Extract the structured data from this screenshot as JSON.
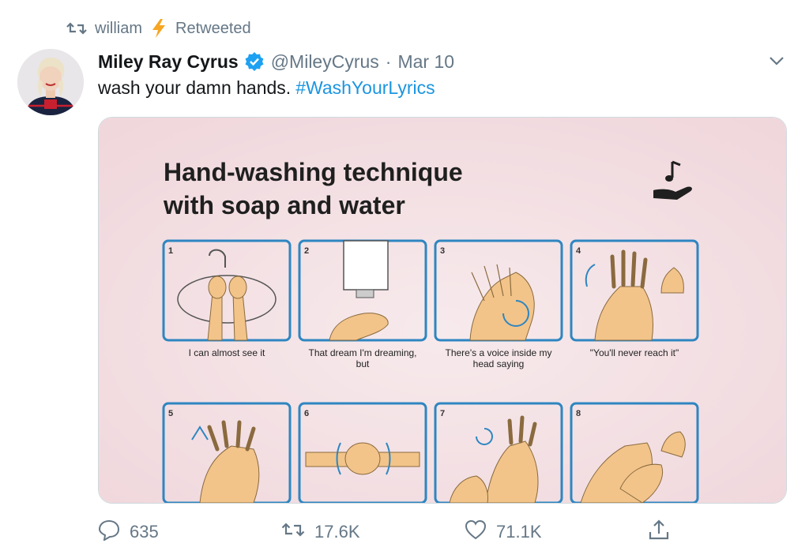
{
  "retweet_context": {
    "icon": "retweet-icon",
    "user": "william",
    "emoji_icon": "lightning-icon",
    "label": "Retweeted"
  },
  "tweet": {
    "display_name": "Miley Ray Cyrus",
    "verified_icon": "verified-badge-icon",
    "handle": "@MileyCyrus",
    "separator": "·",
    "date": "Mar 10",
    "text": "wash your damn hands.",
    "hashtag": "#WashYourLyrics",
    "menu_icon": "chevron-down-icon"
  },
  "poster": {
    "title_line1": "Hand-washing technique",
    "title_line2": "with soap and water",
    "corner_icon": "music-note-hand-icon",
    "steps": [
      {
        "num": "1",
        "caption": "I can almost see it",
        "caption2": ""
      },
      {
        "num": "2",
        "caption": "That dream I'm dreaming,",
        "caption2": "but"
      },
      {
        "num": "3",
        "caption": "There's a voice inside my",
        "caption2": "head saying"
      },
      {
        "num": "4",
        "caption": "\"You'll never reach it\"",
        "caption2": ""
      },
      {
        "num": "5",
        "caption": "",
        "caption2": ""
      },
      {
        "num": "6",
        "caption": "",
        "caption2": ""
      },
      {
        "num": "7",
        "caption": "",
        "caption2": ""
      },
      {
        "num": "8",
        "caption": "",
        "caption2": ""
      }
    ]
  },
  "actions": {
    "reply_count": "635",
    "retweet_count": "17.6K",
    "like_count": "71.1K"
  },
  "colors": {
    "hashtag": "#1b95e0",
    "verified": "#1da1f2",
    "muted": "#657786",
    "poster_bg": "#f3dfe3",
    "frame": "#2e86c1",
    "skin": "#f2c48a",
    "lightning": "#f6a623"
  }
}
